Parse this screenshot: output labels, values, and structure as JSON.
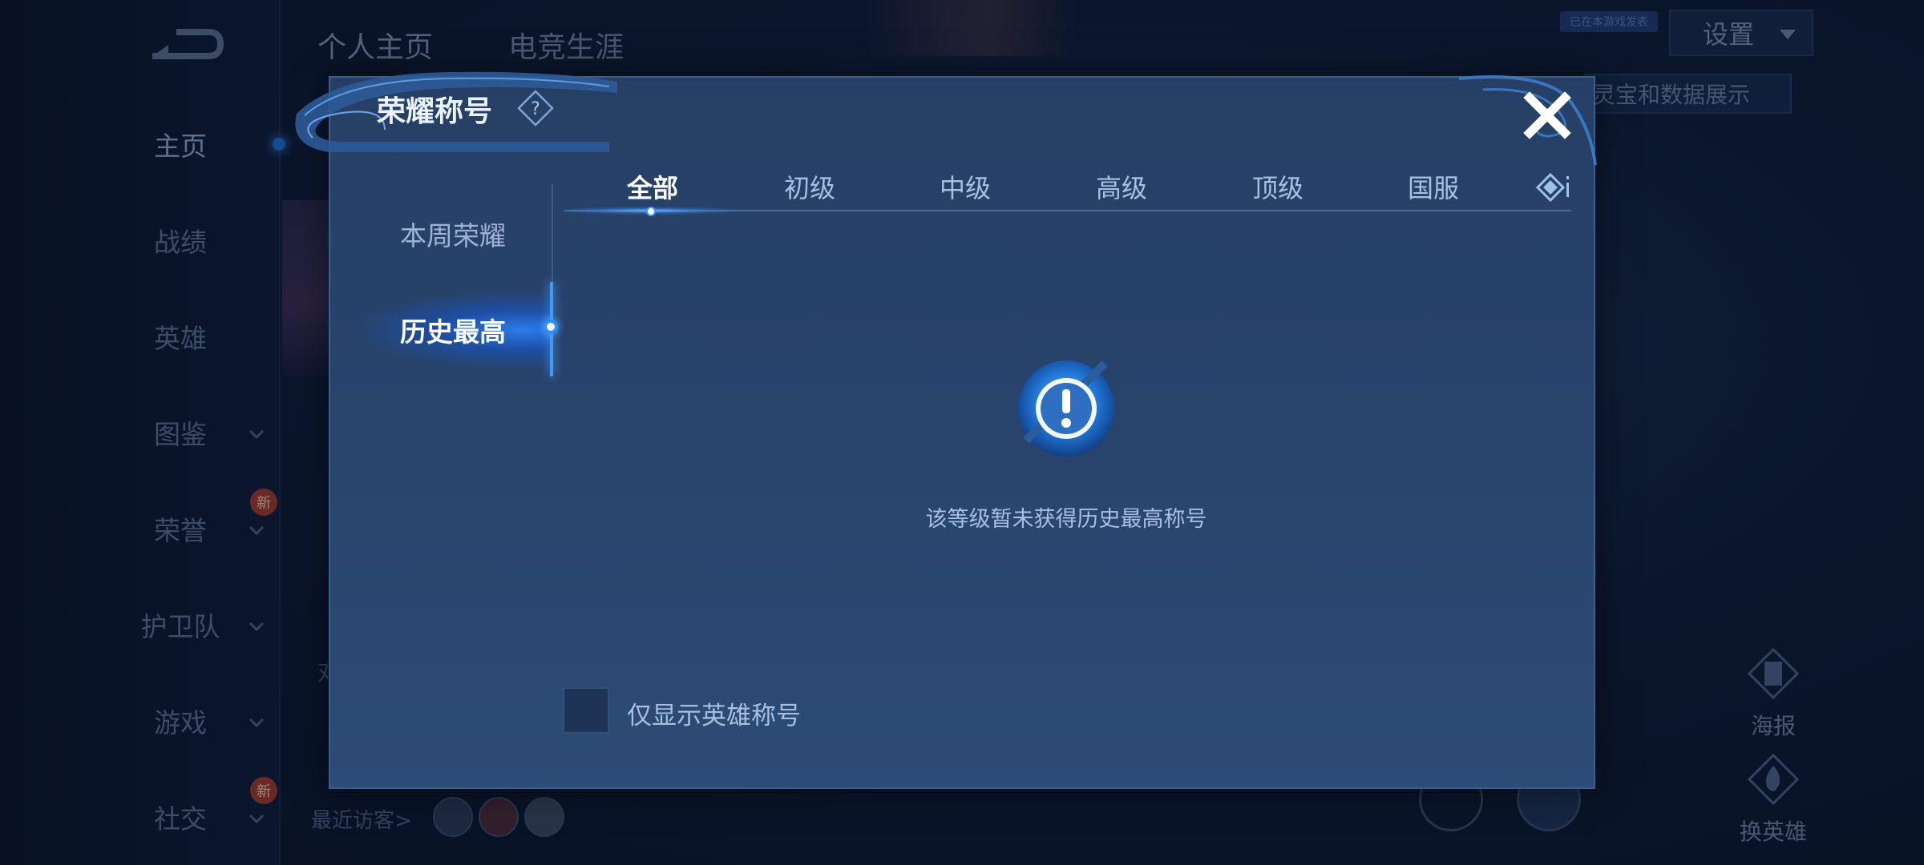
{
  "background": {
    "nav": [
      {
        "label": "主页",
        "has_chevron": false
      },
      {
        "label": "战绩",
        "has_chevron": false
      },
      {
        "label": "英雄",
        "has_chevron": false
      },
      {
        "label": "图鉴",
        "has_chevron": true
      },
      {
        "label": "荣誉",
        "has_chevron": true,
        "badge": "新"
      },
      {
        "label": "护卫队",
        "has_chevron": true
      },
      {
        "label": "游戏",
        "has_chevron": true
      },
      {
        "label": "社交",
        "has_chevron": true,
        "badge": "新"
      }
    ],
    "top_tabs": [
      "个人主页",
      "电竞生涯"
    ],
    "settings_label": "设置",
    "small_chip": "已在本游戏发表",
    "behind_button_text": "灵宝和数据展示",
    "right_buttons": [
      {
        "label": "海报",
        "icon": "poster-icon"
      },
      {
        "label": "换英雄",
        "icon": "swap-hero-icon"
      }
    ],
    "recent_visitors_label": "最近访客>",
    "partial_text": "对"
  },
  "modal": {
    "title": "荣耀称号",
    "side_tabs": [
      "本周荣耀",
      "历史最高"
    ],
    "active_side_tab": 1,
    "categories": [
      "全部",
      "初级",
      "中级",
      "高级",
      "顶级",
      "国服"
    ],
    "active_category": 0,
    "empty_message": "该等级暂未获得历史最高称号",
    "checkbox_label": "仅显示英雄称号",
    "checkbox_checked": false
  },
  "colors": {
    "accent": "#3d9bff",
    "modal_bg": "#28446c",
    "text_primary": "#ffffff",
    "text_secondary": "#a9bfdf"
  }
}
